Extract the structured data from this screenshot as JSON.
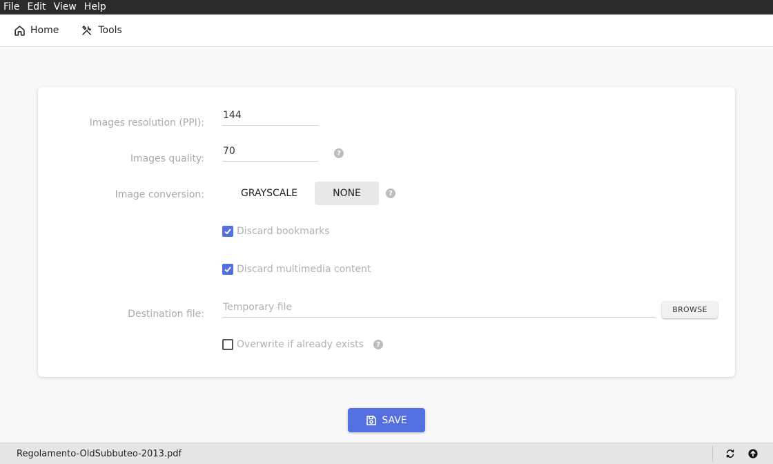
{
  "menubar": {
    "items": [
      "File",
      "Edit",
      "View",
      "Help"
    ]
  },
  "nav": {
    "home_label": "Home",
    "tools_label": "Tools"
  },
  "form": {
    "resolution_label": "Images resolution (PPI):",
    "resolution_value": "144",
    "quality_label": "Images quality:",
    "quality_value": "70",
    "conversion_label": "Image conversion:",
    "conversion_options": [
      "GRAYSCALE",
      "NONE"
    ],
    "conversion_selected": "NONE",
    "discard_bookmarks_label": "Discard bookmarks",
    "discard_bookmarks_checked": true,
    "discard_multimedia_label": "Discard multimedia content",
    "discard_multimedia_checked": true,
    "destination_label": "Destination file:",
    "destination_placeholder": "Temporary file",
    "browse_label": "BROWSE",
    "overwrite_label": "Overwrite if already exists",
    "overwrite_checked": false
  },
  "save_label": "SAVE",
  "footer": {
    "filename": "Regolamento-OldSubbuteo-2013.pdf"
  },
  "colors": {
    "accent": "#5470e0",
    "menubar": "#2b2b2b"
  },
  "icons": [
    "home-icon",
    "tools-icon",
    "help-icon",
    "save-icon",
    "refresh-icon",
    "arrow-up-circle-icon"
  ]
}
